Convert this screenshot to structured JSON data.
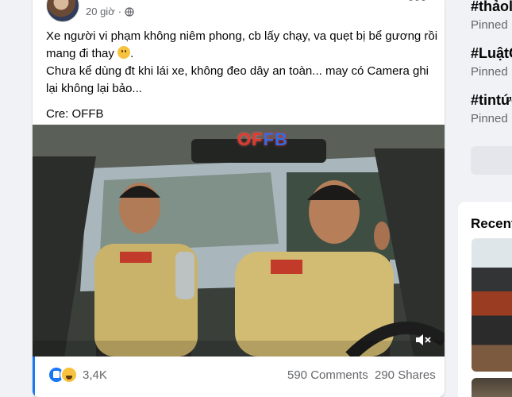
{
  "post": {
    "time": "20 giờ",
    "text_line1": "Xe người vi phạm không niêm phong, cb lấy chạy, va quẹt bị bể gương rồi mang đi thay",
    "text_line1_end": ".",
    "text_line2": "Chưa kể dùng đt khi lái xe, không đeo dây an toàn... may có Camera ghi lại không lại bảo...",
    "credit": "Cre: OFFB",
    "video": {
      "watermark_a": "OF",
      "watermark_b": "FB"
    },
    "reactions": {
      "count": "3,4K",
      "icons": [
        "like-icon",
        "haha-icon"
      ]
    },
    "comments": "590 Comments",
    "shares": "290 Shares"
  },
  "sidebar": {
    "topics": [
      {
        "tag": "#thảol",
        "status": "Pinned"
      },
      {
        "tag": "#LuậtG",
        "status": "Pinned"
      },
      {
        "tag": "#tintức",
        "status": "Pinned"
      }
    ],
    "recent_title": "Recent"
  },
  "colors": {
    "accent": "#1877f2",
    "background": "#f0f2f5",
    "secondary_text": "#65676b"
  }
}
